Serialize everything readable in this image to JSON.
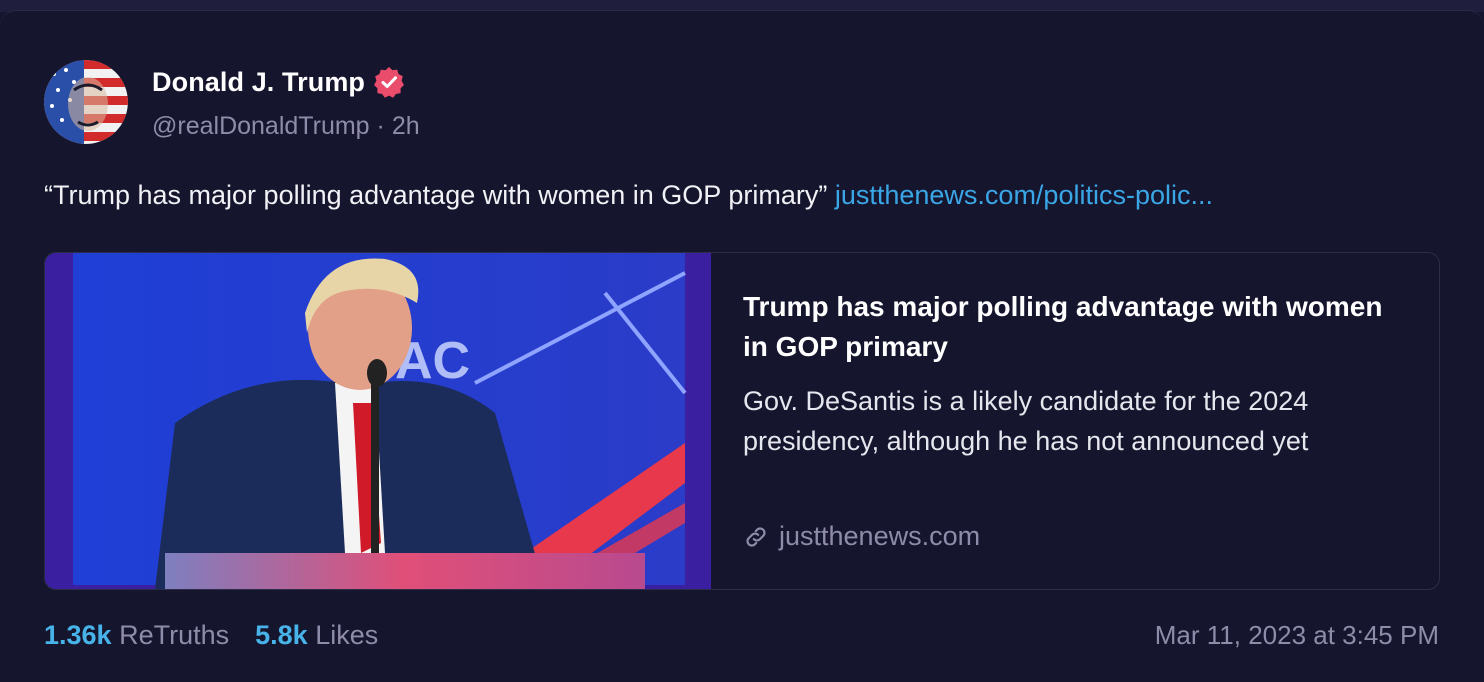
{
  "author": {
    "name": "Donald J. Trump",
    "verified": true,
    "handle": "@realDonaldTrump",
    "separator": "·",
    "time_ago": "2h"
  },
  "post": {
    "text": "“Trump has major polling advantage with women in GOP primary”",
    "link_text": "justthenews.com/politics-polic..."
  },
  "link_card": {
    "title": "Trump has major polling advantage with women in GOP primary",
    "description": "Gov. DeSantis is a likely candidate for the 2024 presidency, although he has not announced yet",
    "domain": "justthenews.com",
    "domain_icon": "link-icon"
  },
  "stats": {
    "retruths_count": "1.36k",
    "retruths_label": "ReTruths",
    "likes_count": "5.8k",
    "likes_label": "Likes"
  },
  "timestamp": "Mar 11, 2023 at 3:45 PM",
  "colors": {
    "background": "#15152e",
    "link": "#3aa6e6",
    "stat_number": "#47b3e8",
    "muted": "#8e8ca8",
    "verified_badge": "#ea4c6b"
  }
}
